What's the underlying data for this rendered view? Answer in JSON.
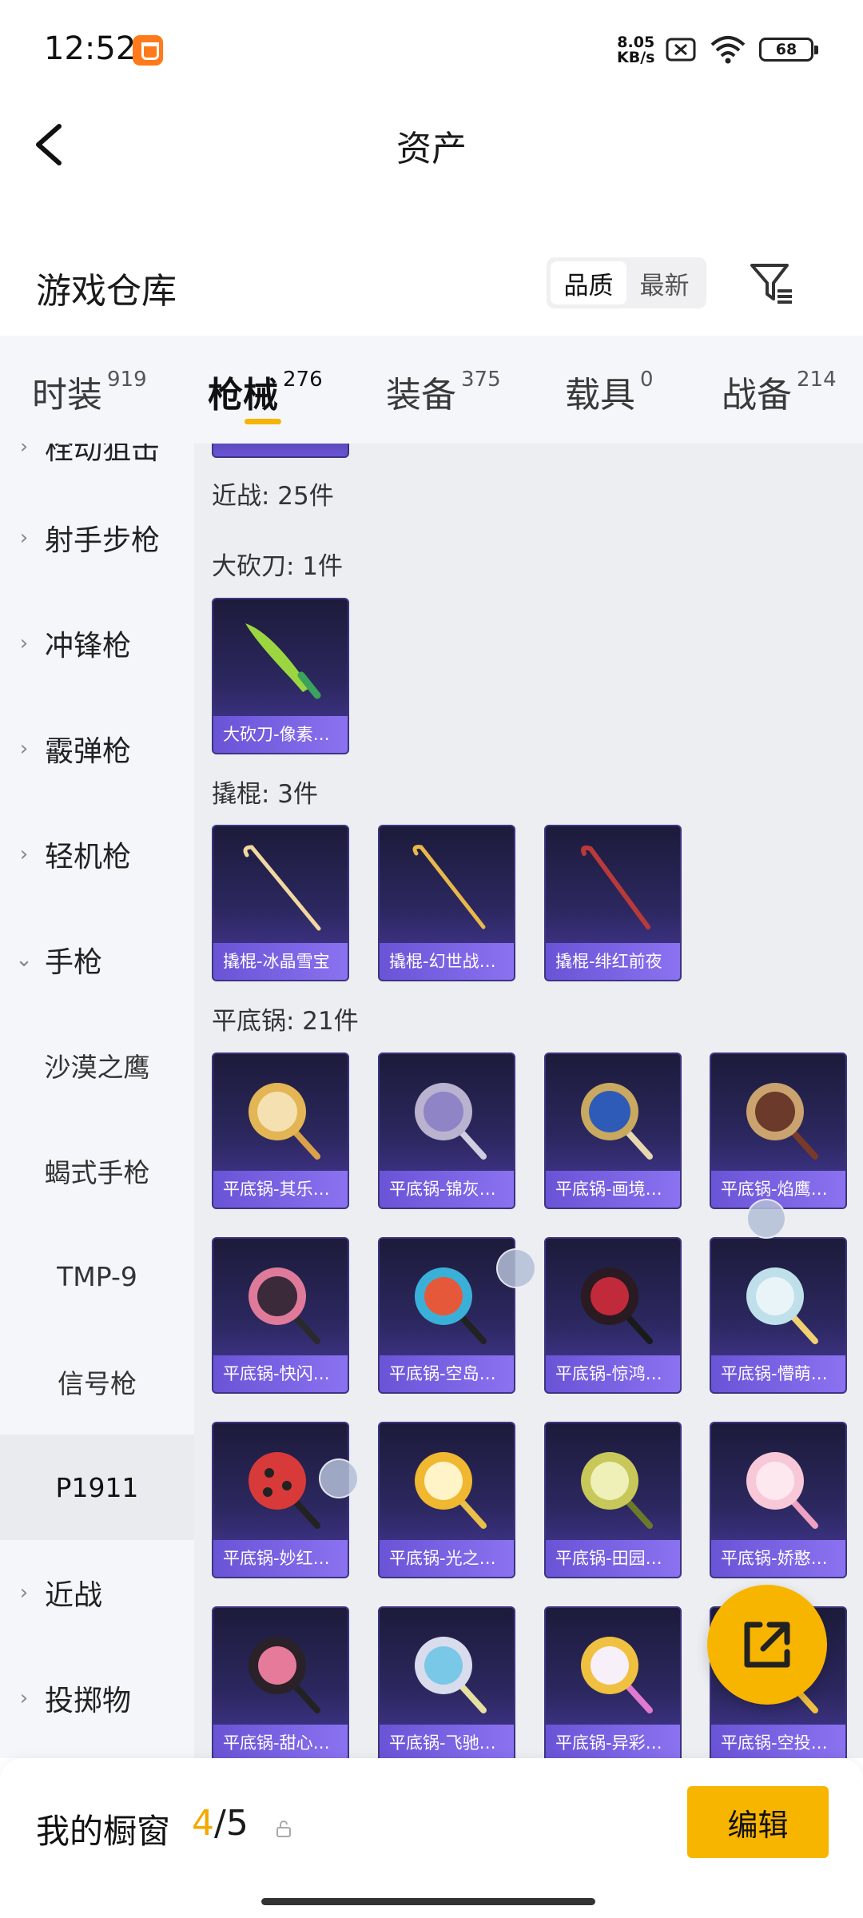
{
  "status": {
    "time": "12:52",
    "speed_value": "8.05",
    "speed_unit": "KB/s",
    "battery": "68"
  },
  "header": {
    "title": "资产"
  },
  "warehouse": {
    "title": "游戏仓库",
    "sort_options": [
      "品质",
      "最新"
    ],
    "active_sort": "品质"
  },
  "tabs": [
    {
      "label": "时装",
      "count": "919"
    },
    {
      "label": "枪械",
      "count": "276",
      "active": true
    },
    {
      "label": "装备",
      "count": "375"
    },
    {
      "label": "载具",
      "count": "0"
    },
    {
      "label": "战备",
      "count": "214"
    }
  ],
  "sidebar": {
    "items": [
      {
        "label": "栓动狙击",
        "type": "category"
      },
      {
        "label": "射手步枪",
        "type": "category"
      },
      {
        "label": "冲锋枪",
        "type": "category"
      },
      {
        "label": "霰弹枪",
        "type": "category"
      },
      {
        "label": "轻机枪",
        "type": "category"
      },
      {
        "label": "手枪",
        "type": "category",
        "expanded": true
      },
      {
        "label": "沙漠之鹰",
        "type": "sub"
      },
      {
        "label": "蝎式手枪",
        "type": "sub"
      },
      {
        "label": "TMP-9",
        "type": "sub"
      },
      {
        "label": "信号枪",
        "type": "sub"
      },
      {
        "label": "P1911",
        "type": "sub",
        "active": true
      },
      {
        "label": "近战",
        "type": "category"
      },
      {
        "label": "投掷物",
        "type": "category"
      }
    ]
  },
  "content": {
    "melee_header": "近战: 25件",
    "sections": [
      {
        "title": "大砍刀: 1件",
        "items": [
          "大砍刀-像素…"
        ]
      },
      {
        "title": "撬棍: 3件",
        "items": [
          "撬棍-冰晶雪宝",
          "撬棍-幻世战…",
          "撬棍-绯红前夜"
        ]
      },
      {
        "title": "平底锅: 21件",
        "items": [
          "平底锅-其乐…",
          "平底锅-锦灰…",
          "平底锅-画境…",
          "平底锅-焰鹰…",
          "平底锅-快闪…",
          "平底锅-空岛…",
          "平底锅-惊鸿…",
          "平底锅-懵萌…",
          "平底锅-妙红…",
          "平底锅-光之…",
          "平底锅-田园…",
          "平底锅-娇憨…",
          "平底锅-甜心…",
          "平底锅-飞驰…",
          "平底锅-异彩…",
          "平底锅-空投…"
        ]
      }
    ]
  },
  "bottom": {
    "title": "我的橱窗",
    "current": "4",
    "total": "/5",
    "edit_label": "编辑"
  },
  "colors": {
    "accent": "#f7b500",
    "card_label": "#7a62e6"
  }
}
